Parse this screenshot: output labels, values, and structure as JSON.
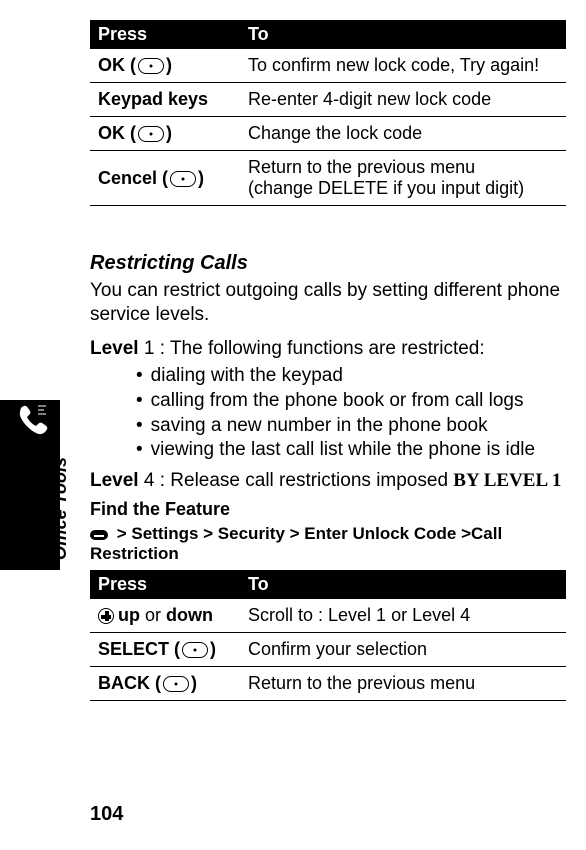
{
  "side_label": "Office Tools",
  "page_number": "104",
  "table1": {
    "headers": {
      "press": "Press",
      "to": "To"
    },
    "rows": [
      {
        "press_label": "OK (",
        "press_close": ")",
        "to": "To confirm new lock code, Try again!"
      },
      {
        "press_label": "Keypad keys",
        "press_close": "",
        "to": "Re-enter 4-digit new lock code"
      },
      {
        "press_label": "OK (",
        "press_close": ")",
        "to": "Change the lock code"
      },
      {
        "press_label": "Cencel (",
        "press_close": ")",
        "to": "Return to the previous menu\n(change DELETE if you input digit)"
      }
    ]
  },
  "restricting": {
    "heading": "Restricting Calls",
    "intro": "You can restrict outgoing calls by setting different phone service levels.",
    "level1_prefix": "Level",
    "level1_num": " 1 : ",
    "level1_text": "The following functions are restricted:",
    "bullets": [
      "dialing with the keypad",
      "calling from the phone book or from call logs",
      "saving a new number in the phone book",
      "viewing the last call list while the phone is idle"
    ],
    "level4_prefix": "Level",
    "level4_num": " 4 : ",
    "level4_text": "Release call restrictions imposed ",
    "level4_caps": "BY LEVEL 1",
    "find_feature": "Find the Feature",
    "breadcrumb": " > Settings > Security > Enter Unlock Code >Call Restriction"
  },
  "table2": {
    "headers": {
      "press": "Press",
      "to": "To"
    },
    "rows": [
      {
        "press_label_pre": "",
        "press_label_bold1": "up",
        "press_label_mid": " or ",
        "press_label_bold2": "down",
        "to": "Scroll to : Level 1 or Level 4"
      },
      {
        "press_label": "SELECT (",
        "press_close": ")",
        "to": "Confirm your selection"
      },
      {
        "press_label": "BACK (",
        "press_close": ")",
        "to": "Return to the previous menu"
      }
    ]
  }
}
